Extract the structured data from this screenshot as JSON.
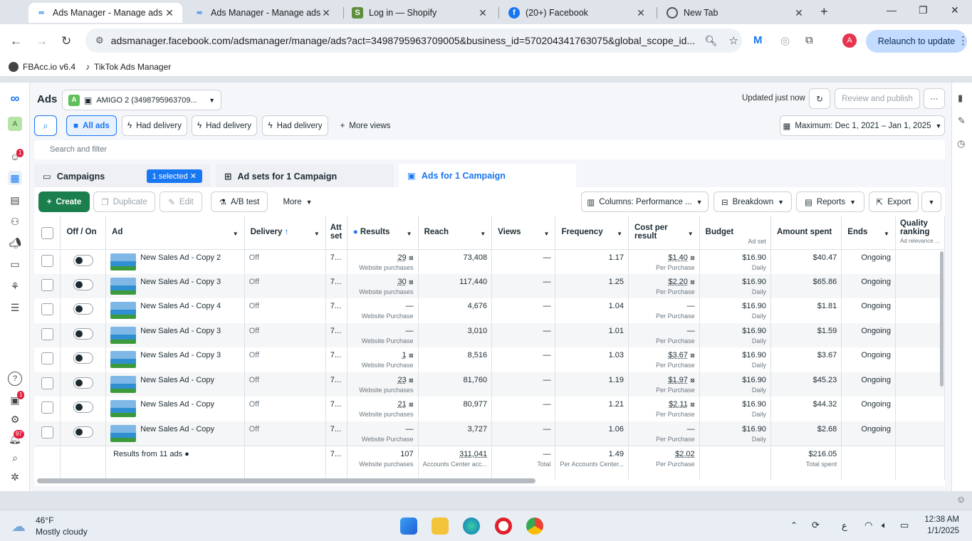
{
  "browser": {
    "tabs": [
      {
        "title": "Ads Manager - Manage ads",
        "icon": "meta-icon"
      },
      {
        "title": "Ads Manager - Manage ads",
        "icon": "meta-icon"
      },
      {
        "title": "Log in — Shopify",
        "icon": "shopify-icon"
      },
      {
        "title": "(20+) Facebook",
        "icon": "facebook-icon"
      },
      {
        "title": "New Tab",
        "icon": "chrome-icon"
      }
    ],
    "url": "adsmanager.facebook.com/adsmanager/manage/ads?act=3498795963709005&business_id=570204341763075&global_scope_id...",
    "relaunch_label": "Relaunch to update",
    "profile_initial": "A",
    "bookmarks": [
      "FBAcc.io v6.4",
      "TikTok Ads Manager"
    ]
  },
  "header": {
    "title": "Ads",
    "account_badge": "A",
    "account_name": "AMIGO 2 (3498795963709...",
    "updated": "Updated just now",
    "review_publish": "Review and publish",
    "more": "···"
  },
  "views": {
    "all_ads": "All ads",
    "view1": "Had delivery",
    "view2": "Had delivery",
    "view3": "Had delivery",
    "more_views": "More views",
    "date_range": "Maximum: Dec 1, 2021 – Jan 1, 2025"
  },
  "search_placeholder": "Search and filter",
  "subtabs": {
    "campaigns": "Campaigns",
    "selected_pill": "1 selected",
    "adsets": "Ad sets for 1 Campaign",
    "ads": "Ads for 1 Campaign"
  },
  "actions": {
    "create": "Create",
    "duplicate": "Duplicate",
    "edit": "Edit",
    "ab_test": "A/B test",
    "more": "More",
    "columns": "Columns: Performance ...",
    "breakdown": "Breakdown",
    "reports": "Reports",
    "export": "Export"
  },
  "table": {
    "headers": {
      "toggle": "Off / On",
      "ad": "Ad",
      "delivery": "Delivery",
      "attribution": "Att set",
      "results": "Results",
      "reach": "Reach",
      "views": "Views",
      "frequency": "Frequency",
      "cpr": "Cost per result",
      "budget": "Budget",
      "budget_sub": "Ad set",
      "spent": "Amount spent",
      "ends": "Ends",
      "quality": "Quality ranking",
      "quality_sub": "Ad relevance ..."
    },
    "rows": [
      {
        "name": "New Sales Ad - Copy 2",
        "delivery": "Off",
        "att": "7...",
        "results": "29",
        "results_sub": "Website purchases",
        "reach": "73,408",
        "views": "—",
        "freq": "1.17",
        "cpr": "$1.40",
        "cpr_sub": "Per Purchase",
        "budget": "$16.90",
        "budget_sub": "Daily",
        "spent": "$40.47",
        "ends": "Ongoing"
      },
      {
        "name": "New Sales Ad - Copy 3",
        "delivery": "Off",
        "att": "7...",
        "results": "30",
        "results_sub": "Website purchases",
        "reach": "117,440",
        "views": "—",
        "freq": "1.25",
        "cpr": "$2.20",
        "cpr_sub": "Per Purchase",
        "budget": "$16.90",
        "budget_sub": "Daily",
        "spent": "$65.86",
        "ends": "Ongoing"
      },
      {
        "name": "New Sales Ad - Copy 4",
        "delivery": "Off",
        "att": "7...",
        "results": "—",
        "results_sub": "Website Purchase",
        "reach": "4,676",
        "views": "—",
        "freq": "1.04",
        "cpr": "—",
        "cpr_sub": "Per Purchase",
        "budget": "$16.90",
        "budget_sub": "Daily",
        "spent": "$1.81",
        "ends": "Ongoing"
      },
      {
        "name": "New Sales Ad - Copy 3",
        "delivery": "Off",
        "att": "7...",
        "results": "—",
        "results_sub": "Website Purchase",
        "reach": "3,010",
        "views": "—",
        "freq": "1.01",
        "cpr": "—",
        "cpr_sub": "Per Purchase",
        "budget": "$16.90",
        "budget_sub": "Daily",
        "spent": "$1.59",
        "ends": "Ongoing"
      },
      {
        "name": "New Sales Ad - Copy 3",
        "delivery": "Off",
        "att": "7...",
        "results": "1",
        "results_sub": "Website Purchase",
        "reach": "8,516",
        "views": "—",
        "freq": "1.03",
        "cpr": "$3.67",
        "cpr_sub": "Per Purchase",
        "budget": "$16.90",
        "budget_sub": "Daily",
        "spent": "$3.67",
        "ends": "Ongoing"
      },
      {
        "name": "New Sales Ad - Copy",
        "delivery": "Off",
        "att": "7...",
        "results": "23",
        "results_sub": "Website purchases",
        "reach": "81,760",
        "views": "—",
        "freq": "1.19",
        "cpr": "$1.97",
        "cpr_sub": "Per Purchase",
        "budget": "$16.90",
        "budget_sub": "Daily",
        "spent": "$45.23",
        "ends": "Ongoing"
      },
      {
        "name": "New Sales Ad - Copy",
        "delivery": "Off",
        "att": "7...",
        "results": "21",
        "results_sub": "Website purchases",
        "reach": "80,977",
        "views": "—",
        "freq": "1.21",
        "cpr": "$2.11",
        "cpr_sub": "Per Purchase",
        "budget": "$16.90",
        "budget_sub": "Daily",
        "spent": "$44.32",
        "ends": "Ongoing"
      },
      {
        "name": "New Sales Ad - Copy",
        "delivery": "Off",
        "att": "7...",
        "results": "—",
        "results_sub": "Website Purchase",
        "reach": "3,727",
        "views": "—",
        "freq": "1.06",
        "cpr": "—",
        "cpr_sub": "Per Purchase",
        "budget": "$16.90",
        "budget_sub": "Daily",
        "spent": "$2.68",
        "ends": "Ongoing"
      }
    ],
    "totals": {
      "label": "Results from 11 ads",
      "att": "7...",
      "results": "107",
      "results_sub": "Website purchases",
      "reach": "311,041",
      "reach_sub": "Accounts Center acc...",
      "views": "—",
      "views_sub": "Total",
      "freq": "1.49",
      "freq_sub": "Per Accounts Center...",
      "cpr": "$2.02",
      "cpr_sub": "Per Purchase",
      "spent": "$216.05",
      "spent_sub": "Total spent"
    }
  },
  "leftrail_badges": {
    "notifications": "1",
    "alerts": "1",
    "messages": "97"
  },
  "taskbar": {
    "temp": "46°F",
    "weather": "Mostly cloudy",
    "time": "12:38 AM",
    "date": "1/1/2025",
    "lang": "ع"
  },
  "colors": {
    "accent": "#1877f2",
    "create": "#1b7f4d",
    "badge": "#e41e3f"
  }
}
